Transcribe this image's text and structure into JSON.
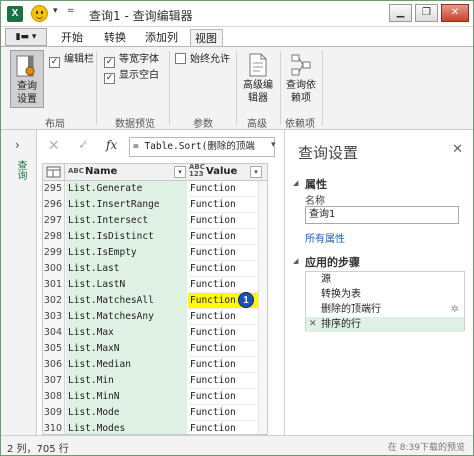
{
  "window": {
    "app_icon_label": "X",
    "title": "查询1 - 查询编辑器",
    "controls": [
      "▁",
      "❐",
      "✕"
    ]
  },
  "ribbon": {
    "file_button": "▮▬ ▾",
    "tabs": [
      "开始",
      "转换",
      "添加列",
      "视图"
    ],
    "active_tab": "视图",
    "query_settings_btn": "查询\n设置",
    "formula_bar_cb": "编辑栏",
    "monospace_cb": "等宽字体",
    "show_whitespace_cb": "显示空白",
    "always_allow_cb": "始终允许",
    "advanced_editor_btn": "高级编\n辑器",
    "query_deps_btn": "查询依\n赖项",
    "groups": [
      "布局",
      "数据预览",
      "参数",
      "高级",
      "依赖项"
    ]
  },
  "left_strip": {
    "label": "查询"
  },
  "formula": {
    "text": "= Table.Sort(删除的顶端"
  },
  "grid": {
    "col_name": "Name",
    "col_value": "Value",
    "name_type": "ABC",
    "value_type": "ABC\n123",
    "rows": [
      {
        "n": "295",
        "name": "List.Generate",
        "value": "Function"
      },
      {
        "n": "296",
        "name": "List.InsertRange",
        "value": "Function"
      },
      {
        "n": "297",
        "name": "List.Intersect",
        "value": "Function"
      },
      {
        "n": "298",
        "name": "List.IsDistinct",
        "value": "Function"
      },
      {
        "n": "299",
        "name": "List.IsEmpty",
        "value": "Function"
      },
      {
        "n": "300",
        "name": "List.Last",
        "value": "Function"
      },
      {
        "n": "301",
        "name": "List.LastN",
        "value": "Function"
      },
      {
        "n": "302",
        "name": "List.MatchesAll",
        "value": "Function",
        "highlight": true
      },
      {
        "n": "303",
        "name": "List.MatchesAny",
        "value": "Function"
      },
      {
        "n": "304",
        "name": "List.Max",
        "value": "Function"
      },
      {
        "n": "305",
        "name": "List.MaxN",
        "value": "Function"
      },
      {
        "n": "306",
        "name": "List.Median",
        "value": "Function"
      },
      {
        "n": "307",
        "name": "List.Min",
        "value": "Function"
      },
      {
        "n": "308",
        "name": "List.MinN",
        "value": "Function"
      },
      {
        "n": "309",
        "name": "List.Mode",
        "value": "Function"
      },
      {
        "n": "310",
        "name": "List.Modes",
        "value": "Function"
      }
    ],
    "badge": "1"
  },
  "pane": {
    "title": "查询设置",
    "properties_title": "属性",
    "name_label": "名称",
    "name_value": "查询1",
    "all_properties": "所有属性",
    "applied_steps_title": "应用的步骤",
    "steps": [
      "源",
      "转换为表",
      "删除的顶端行",
      "排序的行"
    ],
    "selected_step": 3
  },
  "status": {
    "left": "2 列，705 行",
    "right": "在 8:39下载的预览"
  },
  "colors": {
    "accent_green": "#217346",
    "selected_row": "#dff0e4",
    "highlight": "#ffff00"
  }
}
